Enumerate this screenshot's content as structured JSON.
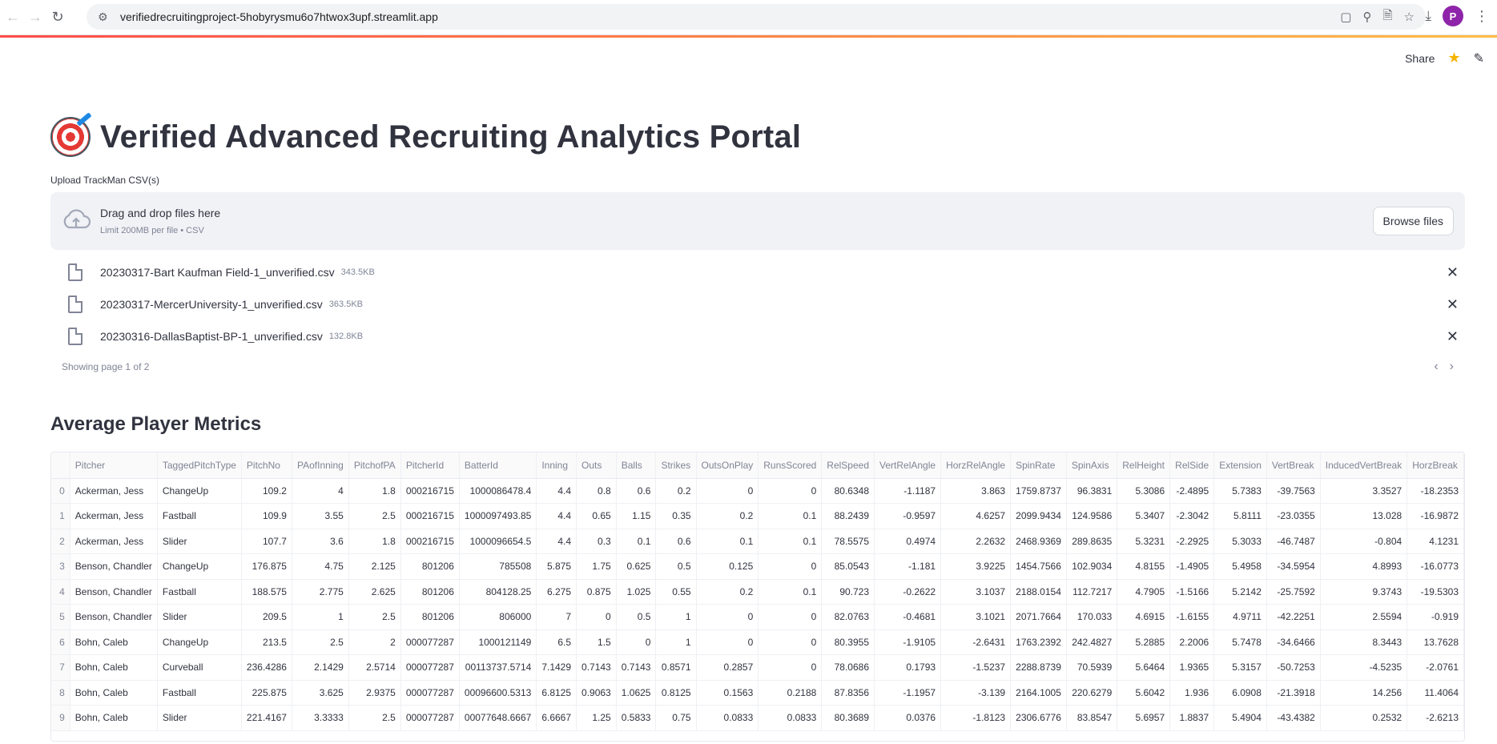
{
  "browser": {
    "url": "verifiedrecruitingproject-5hobyrysmu6o7htwox3upf.streamlit.app",
    "profile_initial": "P"
  },
  "header": {
    "share_label": "Share"
  },
  "main": {
    "title": "Verified Advanced Recruiting Analytics Portal",
    "upload_label": "Upload TrackMan CSV(s)",
    "dropzone_text": "Drag and drop files here",
    "dropzone_limit": "Limit 200MB per file • CSV",
    "browse_label": "Browse files",
    "files": [
      {
        "name": "20230317-Bart Kaufman Field-1_unverified.csv",
        "size": "343.5KB"
      },
      {
        "name": "20230317-MercerUniversity-1_unverified.csv",
        "size": "363.5KB"
      },
      {
        "name": "20230316-DallasBaptist-BP-1_unverified.csv",
        "size": "132.8KB"
      }
    ],
    "pager_text": "Showing page 1 of 2",
    "section_title": "Average Player Metrics"
  },
  "table": {
    "columns": [
      "",
      "Pitcher",
      "TaggedPitchType",
      "PitchNo",
      "PAofInning",
      "PitchofPA",
      "PitcherId",
      "BatterId",
      "Inning",
      "Outs",
      "Balls",
      "Strikes",
      "OutsOnPlay",
      "RunsScored",
      "RelSpeed",
      "VertRelAngle",
      "HorzRelAngle",
      "SpinRate",
      "SpinAxis",
      "RelHeight",
      "RelSide",
      "Extension",
      "VertBreak",
      "InducedVertBreak",
      "HorzBreak"
    ],
    "rows": [
      [
        "0",
        "Ackerman, Jess",
        "ChangeUp",
        "109.2",
        "4",
        "1.8",
        "000216715",
        "1000086478.4",
        "4.4",
        "0.8",
        "0.6",
        "0.2",
        "0",
        "0",
        "80.6348",
        "-1.1187",
        "3.863",
        "1759.8737",
        "96.3831",
        "5.3086",
        "-2.4895",
        "5.7383",
        "-39.7563",
        "3.3527",
        "-18.2353"
      ],
      [
        "1",
        "Ackerman, Jess",
        "Fastball",
        "109.9",
        "3.55",
        "2.5",
        "000216715",
        "1000097493.85",
        "4.4",
        "0.65",
        "1.15",
        "0.35",
        "0.2",
        "0.1",
        "88.2439",
        "-0.9597",
        "4.6257",
        "2099.9434",
        "124.9586",
        "5.3407",
        "-2.3042",
        "5.8111",
        "-23.0355",
        "13.028",
        "-16.9872"
      ],
      [
        "2",
        "Ackerman, Jess",
        "Slider",
        "107.7",
        "3.6",
        "1.8",
        "000216715",
        "1000096654.5",
        "4.4",
        "0.3",
        "0.1",
        "0.6",
        "0.1",
        "0.1",
        "78.5575",
        "0.4974",
        "2.2632",
        "2468.9369",
        "289.8635",
        "5.3231",
        "-2.2925",
        "5.3033",
        "-46.7487",
        "-0.804",
        "4.1231"
      ],
      [
        "3",
        "Benson, Chandler",
        "ChangeUp",
        "176.875",
        "4.75",
        "2.125",
        "801206",
        "785508",
        "5.875",
        "1.75",
        "0.625",
        "0.5",
        "0.125",
        "0",
        "85.0543",
        "-1.181",
        "3.9225",
        "1454.7566",
        "102.9034",
        "4.8155",
        "-1.4905",
        "5.4958",
        "-34.5954",
        "4.8993",
        "-16.0773"
      ],
      [
        "4",
        "Benson, Chandler",
        "Fastball",
        "188.575",
        "2.775",
        "2.625",
        "801206",
        "804128.25",
        "6.275",
        "0.875",
        "1.025",
        "0.55",
        "0.2",
        "0.1",
        "90.723",
        "-0.2622",
        "3.1037",
        "2188.0154",
        "112.7217",
        "4.7905",
        "-1.5166",
        "5.2142",
        "-25.7592",
        "9.3743",
        "-19.5303"
      ],
      [
        "5",
        "Benson, Chandler",
        "Slider",
        "209.5",
        "1",
        "2.5",
        "801206",
        "806000",
        "7",
        "0",
        "0.5",
        "1",
        "0",
        "0",
        "82.0763",
        "-0.4681",
        "3.1021",
        "2071.7664",
        "170.033",
        "4.6915",
        "-1.6155",
        "4.9711",
        "-42.2251",
        "2.5594",
        "-0.919"
      ],
      [
        "6",
        "Bohn, Caleb",
        "ChangeUp",
        "213.5",
        "2.5",
        "2",
        "000077287",
        "1000121149",
        "6.5",
        "1.5",
        "0",
        "1",
        "0",
        "0",
        "80.3955",
        "-1.9105",
        "-2.6431",
        "1763.2392",
        "242.4827",
        "5.2885",
        "2.2006",
        "5.7478",
        "-34.6466",
        "8.3443",
        "13.7628"
      ],
      [
        "7",
        "Bohn, Caleb",
        "Curveball",
        "236.4286",
        "2.1429",
        "2.5714",
        "000077287",
        "00113737.5714",
        "7.1429",
        "0.7143",
        "0.7143",
        "0.8571",
        "0.2857",
        "0",
        "78.0686",
        "0.1793",
        "-1.5237",
        "2288.8739",
        "70.5939",
        "5.6464",
        "1.9365",
        "5.3157",
        "-50.7253",
        "-4.5235",
        "-2.0761"
      ],
      [
        "8",
        "Bohn, Caleb",
        "Fastball",
        "225.875",
        "3.625",
        "2.9375",
        "000077287",
        "00096600.5313",
        "6.8125",
        "0.9063",
        "1.0625",
        "0.8125",
        "0.1563",
        "0.2188",
        "87.8356",
        "-1.1957",
        "-3.139",
        "2164.1005",
        "220.6279",
        "5.6042",
        "1.936",
        "6.0908",
        "-21.3918",
        "14.256",
        "11.4064"
      ],
      [
        "9",
        "Bohn, Caleb",
        "Slider",
        "221.4167",
        "3.3333",
        "2.5",
        "000077287",
        "00077648.6667",
        "6.6667",
        "1.25",
        "0.5833",
        "0.75",
        "0.0833",
        "0.0833",
        "80.3689",
        "0.0376",
        "-1.8123",
        "2306.6776",
        "83.8547",
        "5.6957",
        "1.8837",
        "5.4904",
        "-43.4382",
        "0.2532",
        "-2.6213"
      ]
    ]
  }
}
